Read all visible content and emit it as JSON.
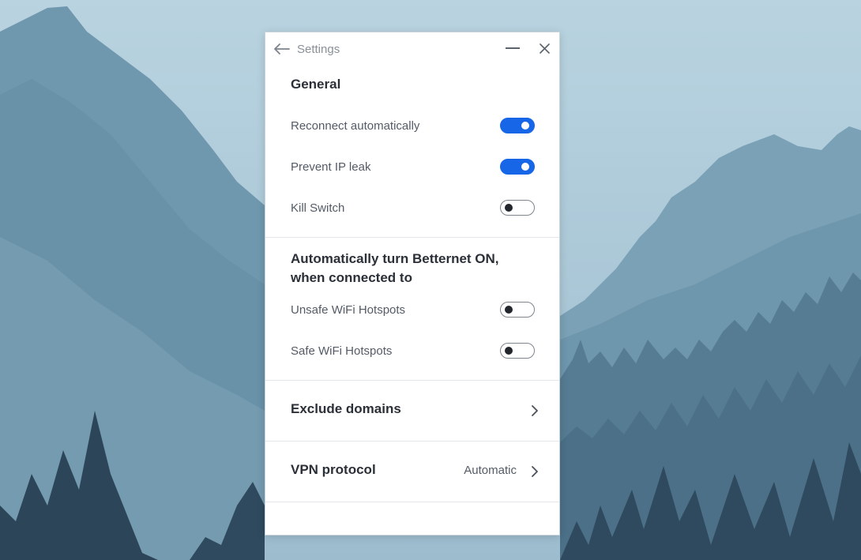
{
  "window": {
    "title": "Settings"
  },
  "general": {
    "heading": "General",
    "items": [
      {
        "label": "Reconnect automatically",
        "enabled": true
      },
      {
        "label": "Prevent IP leak",
        "enabled": true
      },
      {
        "label": "Kill Switch",
        "enabled": false
      }
    ]
  },
  "auto_on": {
    "heading_line1": "Automatically turn Betternet ON,",
    "heading_line2": "when connected to",
    "items": [
      {
        "label": "Unsafe WiFi Hotspots",
        "enabled": false
      },
      {
        "label": "Safe WiFi Hotspots",
        "enabled": false
      }
    ]
  },
  "exclude_domains": {
    "label": "Exclude domains"
  },
  "vpn_protocol": {
    "label": "VPN protocol",
    "value": "Automatic"
  },
  "colors": {
    "accent": "#1766e8",
    "toggle_off_border": "#7f858c",
    "background_sky": "#a9c6d6"
  },
  "icons": [
    "back-arrow-icon",
    "minimize-icon",
    "close-icon",
    "chevron-right-icon"
  ]
}
